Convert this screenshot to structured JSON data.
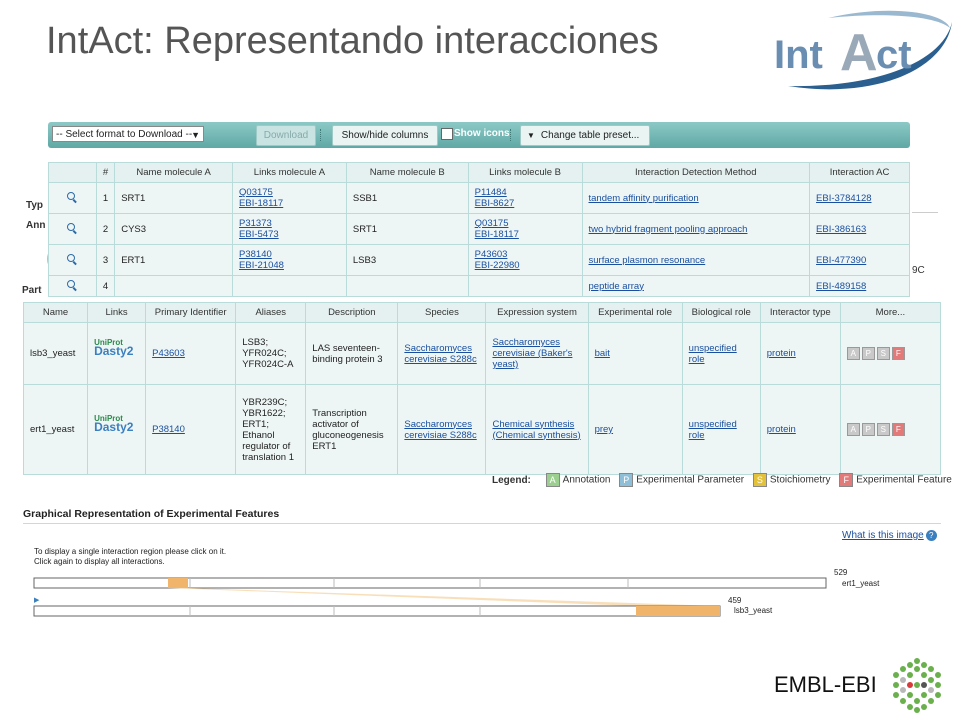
{
  "slide": {
    "title": "IntAct: Representando interacciones"
  },
  "logo": {
    "part1": "Int",
    "part2": "A",
    "part3": "ct"
  },
  "toolbar": {
    "format_select": "-- Select format to Download --",
    "download": "Download",
    "show_hide": "Show/hide columns",
    "show_icons": "Show icons",
    "change_preset": "Change table preset..."
  },
  "interactions": {
    "headers": [
      "",
      "#",
      "Name molecule A",
      "Links molecule A",
      "Name molecule B",
      "Links molecule B",
      "Interaction Detection Method",
      "Interaction AC"
    ],
    "rows": [
      {
        "num": "1",
        "name_a": "SRT1",
        "links_a": [
          "Q03175",
          "EBI-18117"
        ],
        "name_b": "SSB1",
        "links_b": [
          "P11484",
          "EBI-8627"
        ],
        "method": "tandem affinity purification",
        "ac": "EBI-3784128"
      },
      {
        "num": "2",
        "name_a": "CYS3",
        "links_a": [
          "P31373",
          "EBI-5473"
        ],
        "name_b": "SRT1",
        "links_b": [
          "Q03175",
          "EBI-18117"
        ],
        "method": "two hybrid fragment pooling approach",
        "ac": "EBI-386163"
      },
      {
        "num": "3",
        "name_a": "ERT1",
        "links_a": [
          "P38140",
          "EBI-21048"
        ],
        "name_b": "LSB3",
        "links_b": [
          "P43603",
          "EBI-22980"
        ],
        "method": "surface plasmon resonance",
        "ac": "EBI-477390"
      },
      {
        "num": "4",
        "name_a": "",
        "links_a": [
          "",
          ""
        ],
        "name_b": "",
        "links_b": [
          "",
          ""
        ],
        "method": "peptide array",
        "ac": "EBI-489158"
      }
    ]
  },
  "background_fragments": {
    "typ": "Typ",
    "ann": "Ann",
    "part": "Part",
    "suffix": "9C"
  },
  "participants": {
    "headers": [
      "Name",
      "Links",
      "Primary Identifier",
      "Aliases",
      "Description",
      "Species",
      "Expression system",
      "Experimental role",
      "Biological role",
      "Interactor type",
      "More..."
    ],
    "rows": [
      {
        "name": "lsb3_yeast",
        "primary": "P43603",
        "aliases": "LSB3; YFR024C; YFR024C-A",
        "description": "LAS seventeen-binding protein 3",
        "species": "Saccharomyces cerevisiae S288c",
        "expression": "Saccharomyces cerevisiae (Baker's yeast)",
        "exp_role": "bait",
        "bio_role": "unspecified role",
        "type": "protein"
      },
      {
        "name": "ert1_yeast",
        "primary": "P38140",
        "aliases": "YBR239C; YBR1622; ERT1; Ethanol regulator of translation 1",
        "description": "Transcription activator of gluconeogenesis ERT1",
        "species": "Saccharomyces cerevisiae S288c",
        "expression": "Chemical synthesis (Chemical synthesis)",
        "exp_role": "prey",
        "bio_role": "unspecified role",
        "type": "protein"
      }
    ],
    "uniprot_logo": {
      "line1": "UniProt",
      "line2": "Dasty2"
    },
    "badges": [
      "A",
      "P",
      "S",
      "F"
    ]
  },
  "legend": {
    "label": "Legend:",
    "items": [
      {
        "key": "A",
        "label": "Annotation",
        "color": "#9bcf8f"
      },
      {
        "key": "P",
        "label": "Experimental Parameter",
        "color": "#8fbfd8"
      },
      {
        "key": "S",
        "label": "Stoichiometry",
        "color": "#e3c23a"
      },
      {
        "key": "F",
        "label": "Experimental Feature",
        "color": "#e27a7a"
      }
    ]
  },
  "graph": {
    "title": "Graphical Representation of Experimental Features",
    "help": "What is this image",
    "instructions_1": "To display a single interaction region please click on it.",
    "instructions_2": "Click again to display all interactions.",
    "ert1_length": "529",
    "ert1_label": "ert1_yeast",
    "lsb3_length": "459",
    "lsb3_label": "lsb3_yeast"
  },
  "footer": {
    "org": "EMBL-EBI"
  }
}
